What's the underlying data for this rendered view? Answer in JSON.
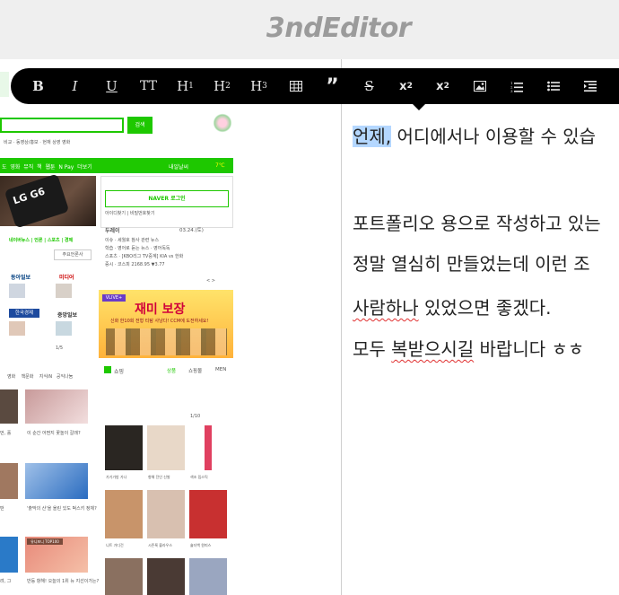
{
  "app": {
    "title": "3ndEditor"
  },
  "toolbar": {
    "bold": "B",
    "italic": "I",
    "underline": "U",
    "text_size": "TT",
    "h1": "H",
    "h1_sup": "1",
    "h2": "H",
    "h2_sup": "2",
    "h3": "H",
    "h3_sup": "3",
    "strike": "S",
    "subscript": "x",
    "subscript_mark": "2",
    "superscript": "x",
    "superscript_mark": "2"
  },
  "editor": {
    "lines": [
      {
        "selected": "언제,",
        "rest": " 어디에서나 이용할 수 있습"
      },
      {
        "text": "포트폴리오 용으로 작성하고 있는"
      },
      {
        "text": "정말 열심히 만들었는데 이런 조"
      },
      {
        "spell": "사람하나",
        "rest": " 있었으면 좋겠다."
      },
      {
        "pre": "모두 ",
        "spell": "복받으시길",
        "rest": " 바랍니다 ㅎㅎ"
      }
    ]
  },
  "preview": {
    "search_button": "검색",
    "nav": [
      "도",
      "영화",
      "뮤직",
      "책",
      "웹툰",
      "N Pay",
      "더보기"
    ],
    "weather": "내일날씨",
    "naver_login": "NAVER 로그인",
    "login_links": "아이디찾기 | 비밀번호찾기",
    "news_tabs": "네이버뉴스 | 언론 | 스포츠 | 경제",
    "press_select": "주요언론사",
    "press": [
      "동아일보",
      "미디어",
      "한국경제",
      "중앙일보"
    ],
    "pagination": "1/5",
    "issue_title": "두레이",
    "issue_date": "03.24.(토)",
    "issue_lines": [
      "이슈 · 세월호 참사 관련 뉴스",
      "학습 · 영어로 듣는 뉴스 · 영어독독",
      "스포츠 · [KBO리그 TV중계] KIA vs 한화",
      "증시 · 코스피 2168.95 ▼3.77"
    ],
    "banner_title": "재미 보장",
    "banner_sub": "신화 한10회 전형 티탐 사냥다! CCM에 도전하세요!",
    "banner_tag": "VLIVE+",
    "shopping_label": "쇼핑",
    "shopping_tabs": [
      "상품",
      "쇼핑몰",
      "MEN"
    ],
    "shopping_page": "1/10",
    "card_captions": [
      "이 순간 어쩐지 꽃놀이 갈래?",
      "'출막의 산'을 올린 있도 벅스키 정체?",
      "반등 항해! 오늘의 1위 뉴 지선이가는?"
    ],
    "card_badge": "유니포니 TOP100",
    "left_captions": [
      "먼, 홀",
      "떤",
      "려, 그"
    ],
    "icon_links": [
      "영화",
      "책문화",
      "지식iN",
      "공익나눔"
    ],
    "product_captions": [
      "가기가방 가나",
      "향해 잔인 신발",
      "색조 립스틱",
      "니트 가디건",
      "시즌룩 블라우스",
      "숄더백 원피스"
    ],
    "pager_arrows": "<  >",
    "temp": "7℃"
  }
}
